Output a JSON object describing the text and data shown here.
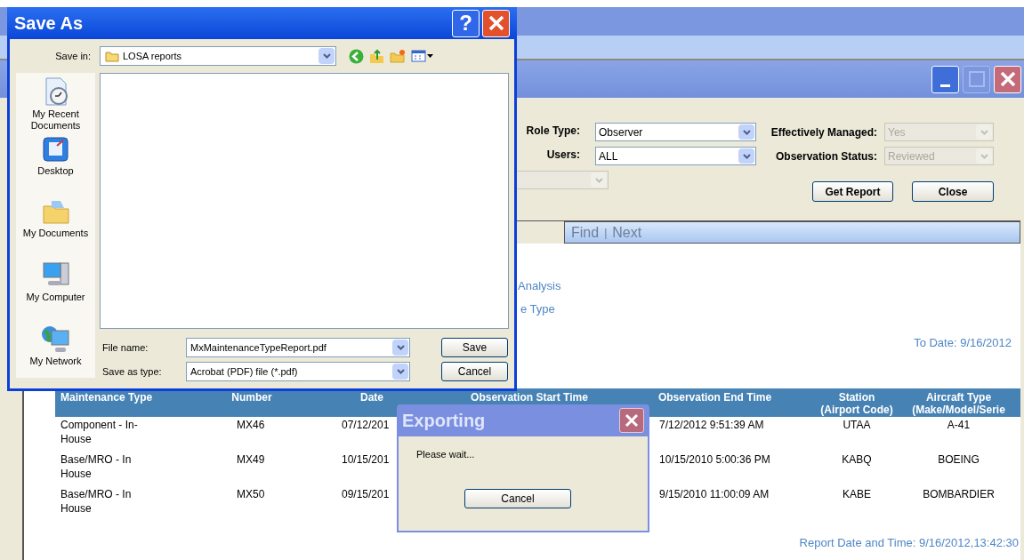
{
  "background_window": {
    "form": {
      "role_type": {
        "label": "Role Type:",
        "value": "Observer",
        "disabled": false
      },
      "users": {
        "label": "Users:",
        "value": "ALL",
        "disabled": false
      },
      "effectively_managed": {
        "label": "Effectively Managed:",
        "value": "Yes",
        "disabled": true
      },
      "observation_status": {
        "label": "Observation Status:",
        "value": "Reviewed",
        "disabled": true
      },
      "partial_filter": {
        "disabled": true
      },
      "buttons": [
        "Get Report",
        "Close"
      ]
    },
    "report_toolbar": {
      "find": "Find",
      "separator": "|",
      "next": "Next",
      "disabled": true
    },
    "report": {
      "title_line_1": "Analysis",
      "title_line_2": "e Type",
      "to_date": "To Date: 9/16/2012",
      "columns": [
        {
          "label": "Maintenance Type"
        },
        {
          "label": "Number"
        },
        {
          "label": "Date"
        },
        {
          "label": "Observation Start Time"
        },
        {
          "label": "Observation End Time"
        },
        {
          "label": "Station",
          "sublabel": "(Airport Code)"
        },
        {
          "label": "Aircraft Type",
          "sublabel": "(Make/Model/Serie"
        }
      ],
      "rows": [
        [
          "Component - In-House",
          "MX46",
          "07/12/201",
          "",
          "7/12/2012 9:51:39 AM",
          "UTAA",
          "A-41"
        ],
        [
          "Base/MRO - In House",
          "MX49",
          "10/15/201",
          "",
          "10/15/2010 5:00:36 PM",
          "KABQ",
          "BOEING"
        ],
        [
          "Base/MRO - In House",
          "MX50",
          "09/15/201",
          "",
          "9/15/2010 11:00:09 AM",
          "KABE",
          "BOMBARDIER"
        ]
      ],
      "footer": "Report Date and Time: 9/16/2012,13:42:30"
    }
  },
  "save_as_dialog": {
    "title": "Save As",
    "help": "?",
    "save_in": {
      "label": "Save in:",
      "value": "LOSA reports"
    },
    "places": [
      {
        "kind": "recent",
        "label": "My Recent Documents"
      },
      {
        "kind": "desktop",
        "label": "Desktop"
      },
      {
        "kind": "documents",
        "label": "My Documents"
      },
      {
        "kind": "computer",
        "label": "My Computer"
      },
      {
        "kind": "network",
        "label": "My Network"
      }
    ],
    "file_name": {
      "label": "File name:",
      "value": "MxMaintenanceTypeReport.pdf"
    },
    "save_as_type": {
      "label": "Save as type:",
      "value": "Acrobat (PDF) file (*.pdf)"
    },
    "buttons": [
      "Save",
      "Cancel"
    ]
  },
  "exporting_dialog": {
    "title": "Exporting",
    "message": "Please wait...",
    "button": "Cancel"
  }
}
